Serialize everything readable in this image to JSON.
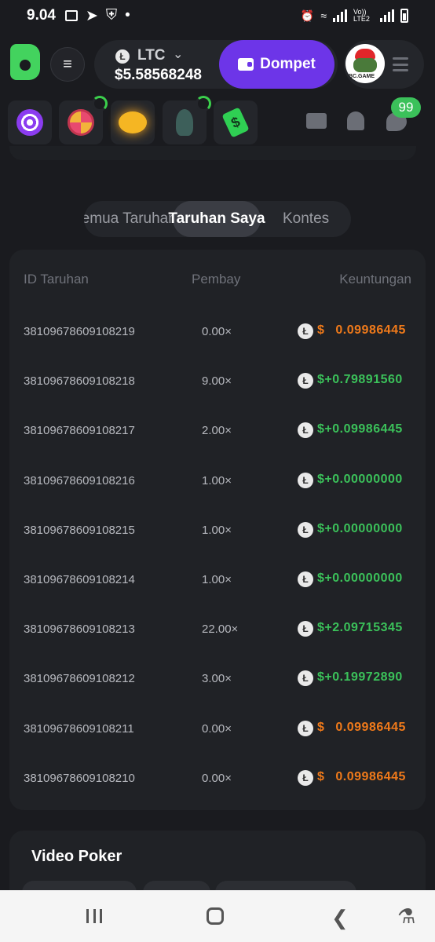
{
  "status": {
    "time": "9.04",
    "network": "Vo)) LTE2"
  },
  "header": {
    "currency": "LTC",
    "balance": "$5.58568248",
    "wallet_label": "Dompet",
    "avatar_text": "BC.GAME",
    "notifications_count": "99"
  },
  "tabs": [
    {
      "label": "Semua Taruhan",
      "active": false
    },
    {
      "label": "Taruhan Saya",
      "active": true
    },
    {
      "label": "Kontes",
      "active": false
    }
  ],
  "table": {
    "headers": {
      "id": "ID Taruhan",
      "payout": "Pembay",
      "profit": "Keuntungan"
    },
    "rows": [
      {
        "id": "38109678609108219",
        "payout": "0.00×",
        "profit_sign": "$",
        "profit": "0.09986445",
        "positive": false
      },
      {
        "id": "38109678609108218",
        "payout": "9.00×",
        "profit_sign": "$",
        "profit": "+0.79891560",
        "positive": true
      },
      {
        "id": "38109678609108217",
        "payout": "2.00×",
        "profit_sign": "$",
        "profit": "+0.09986445",
        "positive": true
      },
      {
        "id": "38109678609108216",
        "payout": "1.00×",
        "profit_sign": "$",
        "profit": "+0.00000000",
        "positive": true
      },
      {
        "id": "38109678609108215",
        "payout": "1.00×",
        "profit_sign": "$",
        "profit": "+0.00000000",
        "positive": true
      },
      {
        "id": "38109678609108214",
        "payout": "1.00×",
        "profit_sign": "$",
        "profit": "+0.00000000",
        "positive": true
      },
      {
        "id": "38109678609108213",
        "payout": "22.00×",
        "profit_sign": "$",
        "profit": "+2.09715345",
        "positive": true
      },
      {
        "id": "38109678609108212",
        "payout": "3.00×",
        "profit_sign": "$",
        "profit": "+0.19972890",
        "positive": true
      },
      {
        "id": "38109678609108211",
        "payout": "0.00×",
        "profit_sign": "$",
        "profit": "0.09986445",
        "positive": false
      },
      {
        "id": "38109678609108210",
        "payout": "0.00×",
        "profit_sign": "$",
        "profit": "0.09986445",
        "positive": false
      }
    ]
  },
  "section": {
    "title": "Video Poker"
  },
  "colors": {
    "accent": "#6d35e8",
    "positive": "#3bc15a",
    "negative": "#f07a1a",
    "brand": "#43d35e"
  }
}
